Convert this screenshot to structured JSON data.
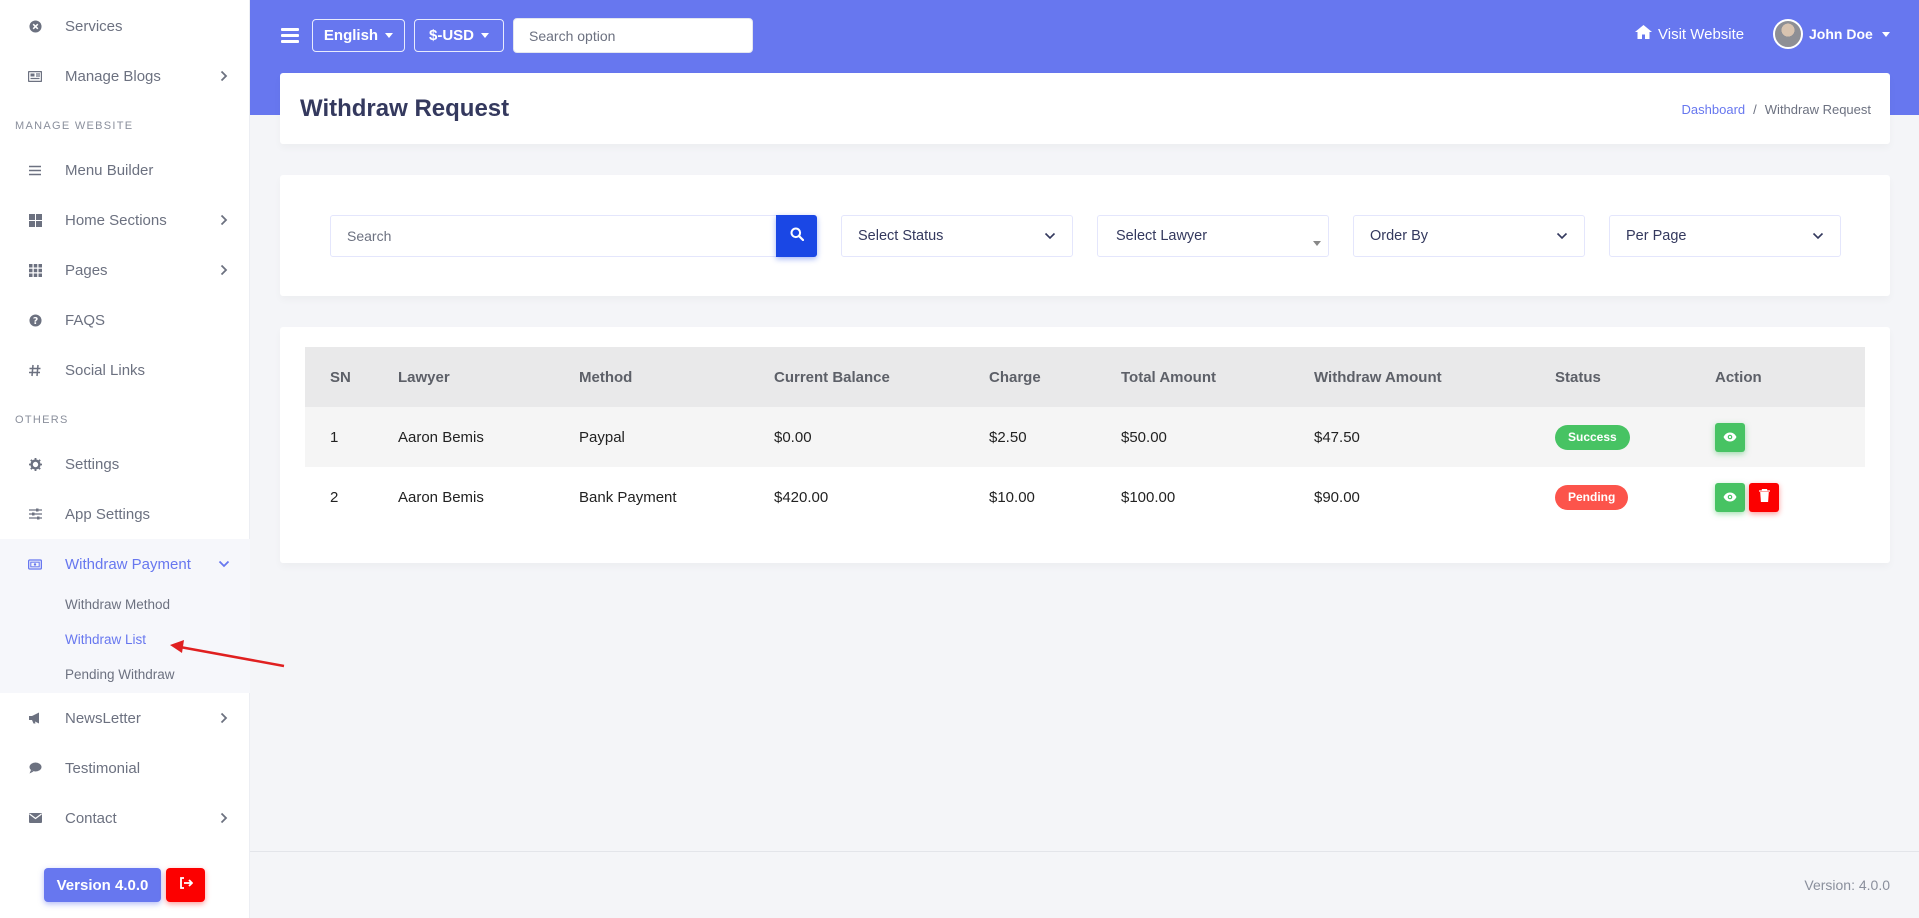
{
  "sidebar": {
    "items": [
      {
        "label": "Services",
        "icon": "times-circle-icon"
      },
      {
        "label": "Manage Blogs",
        "icon": "newspaper-icon"
      },
      {
        "label": "Menu Builder",
        "icon": "bars-icon"
      },
      {
        "label": "Home Sections",
        "icon": "grid-icon"
      },
      {
        "label": "Pages",
        "icon": "th-icon"
      },
      {
        "label": "FAQS",
        "icon": "question-circle-icon"
      },
      {
        "label": "Social Links",
        "icon": "hashtag-icon"
      },
      {
        "label": "Settings",
        "icon": "cog-icon"
      },
      {
        "label": "App Settings",
        "icon": "sliders-icon"
      },
      {
        "label": "Withdraw Payment",
        "icon": "money-bill-icon"
      },
      {
        "label": "NewsLetter",
        "icon": "bullhorn-icon"
      },
      {
        "label": "Testimonial",
        "icon": "comment-icon"
      },
      {
        "label": "Contact",
        "icon": "envelope-icon"
      }
    ],
    "headers": {
      "manage_website": "MANAGE WEBSITE",
      "others": "OTHERS"
    },
    "submenu": {
      "withdraw_method": "Withdraw Method",
      "withdraw_list": "Withdraw List",
      "pending_withdraw": "Pending Withdraw"
    },
    "version_button": "Version 4.0.0"
  },
  "topbar": {
    "language": "English",
    "currency": "$-USD",
    "search_placeholder": "Search option",
    "visit_website": "Visit Website",
    "user_name": "John Doe"
  },
  "page": {
    "title": "Withdraw Request",
    "breadcrumb": {
      "home": "Dashboard",
      "separator": "/",
      "current": "Withdraw Request"
    }
  },
  "filters": {
    "search_placeholder": "Search",
    "status": "Select Status",
    "lawyer": "Select Lawyer",
    "order_by": "Order By",
    "per_page": "Per Page"
  },
  "table": {
    "headers": [
      "SN",
      "Lawyer",
      "Method",
      "Current Balance",
      "Charge",
      "Total Amount",
      "Withdraw Amount",
      "Status",
      "Action"
    ],
    "rows": [
      {
        "sn": "1",
        "lawyer": "Aaron Bemis",
        "method": "Paypal",
        "current_balance": "$0.00",
        "charge": "$2.50",
        "total_amount": "$50.00",
        "withdraw_amount": "$47.50",
        "status": "Success"
      },
      {
        "sn": "2",
        "lawyer": "Aaron Bemis",
        "method": "Bank Payment",
        "current_balance": "$420.00",
        "charge": "$10.00",
        "total_amount": "$100.00",
        "withdraw_amount": "$90.00",
        "status": "Pending"
      }
    ]
  },
  "footer": {
    "version": "Version: 4.0.0"
  },
  "colors": {
    "primary": "#6777ef",
    "success": "#47c363",
    "danger": "#fc544b",
    "delete": "#fc0000",
    "search_button": "#1a47e5"
  }
}
